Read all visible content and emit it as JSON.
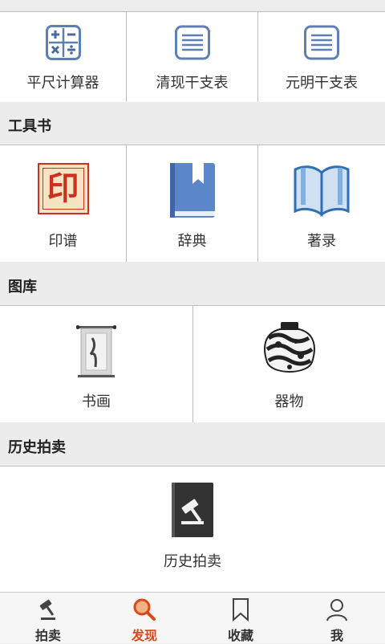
{
  "tools_row": [
    {
      "label": "平尺计算器",
      "icon": "calculator-icon"
    },
    {
      "label": "清现干支表",
      "icon": "list-table-icon"
    },
    {
      "label": "元明干支表",
      "icon": "list-table-icon"
    }
  ],
  "sections": {
    "books": {
      "title": "工具书",
      "items": [
        {
          "label": "印谱",
          "icon": "seal-icon",
          "glyph": "印"
        },
        {
          "label": "辞典",
          "icon": "dictionary-book-icon"
        },
        {
          "label": "著录",
          "icon": "open-book-icon"
        }
      ]
    },
    "gallery": {
      "title": "图库",
      "items": [
        {
          "label": "书画",
          "icon": "scroll-painting-icon"
        },
        {
          "label": "器物",
          "icon": "porcelain-vase-icon"
        }
      ]
    },
    "auction": {
      "title": "历史拍卖",
      "items": [
        {
          "label": "历史拍卖",
          "icon": "auction-gavel-book-icon"
        }
      ]
    }
  },
  "bottom_nav": [
    {
      "label": "拍卖",
      "icon": "gavel-icon",
      "active": false
    },
    {
      "label": "发现",
      "icon": "search-icon",
      "active": true
    },
    {
      "label": "收藏",
      "icon": "bookmark-icon",
      "active": false
    },
    {
      "label": "我",
      "icon": "user-icon",
      "active": false
    }
  ],
  "colors": {
    "accent": "#d9491a",
    "icon_blue": "#6a8cc0",
    "seal_red": "#c8321e"
  }
}
